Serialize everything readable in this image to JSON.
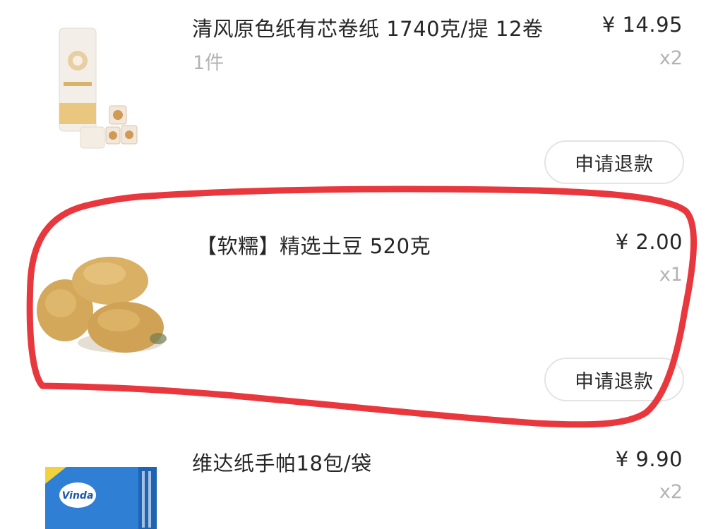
{
  "items": [
    {
      "title": "清风原色纸有芯卷纸 1740克/提 12卷",
      "subtitle": "1件",
      "price": "¥ 14.95",
      "qty": "x2",
      "refund_label": "申请退款",
      "image_icon": "toilet-paper-image"
    },
    {
      "title": "【软糯】精选土豆 520克",
      "price": "¥ 2.00",
      "qty": "x1",
      "refund_label": "申请退款",
      "image_icon": "potato-image"
    },
    {
      "title": "维达纸手帕18包/袋",
      "price": "¥ 9.90",
      "qty": "x2",
      "image_icon": "tissue-pack-image",
      "logo_text": "Vinda"
    }
  ],
  "annotation_color": "#e8373d"
}
